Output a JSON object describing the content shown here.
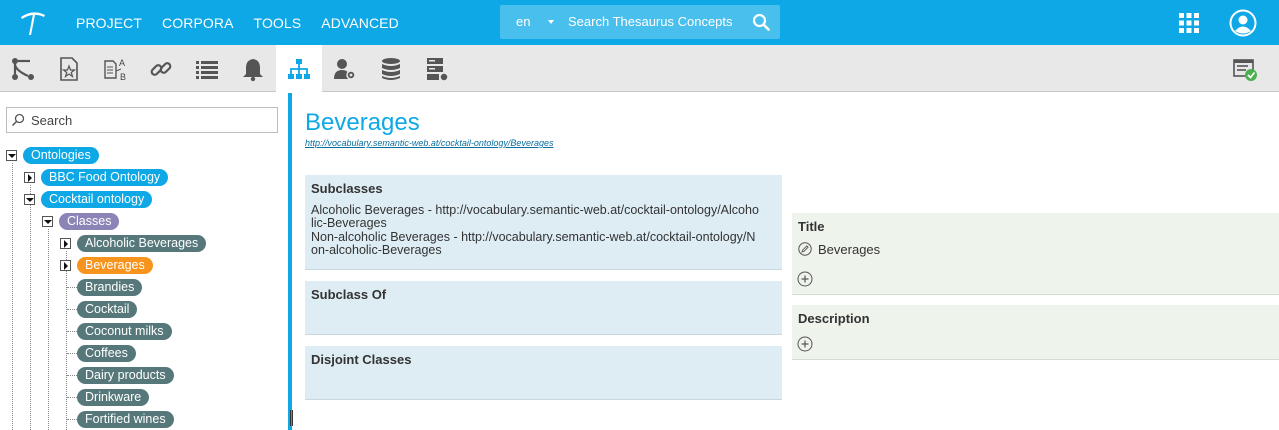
{
  "topbar": {
    "nav": [
      "PROJECT",
      "CORPORA",
      "TOOLS",
      "ADVANCED"
    ],
    "search": {
      "lang": "en",
      "placeholder": "Search Thesaurus Concepts"
    },
    "icons": [
      "logo-icon",
      "search-icon",
      "apps-grid-icon",
      "user-icon"
    ]
  },
  "toolbar": {
    "tools": [
      "hierarchy-branch-icon",
      "document-star-icon",
      "translate-ab-icon",
      "link-icon",
      "list-icon",
      "bell-icon",
      "sitemap-icon",
      "user-settings-icon",
      "database-icon",
      "server-icon"
    ],
    "active": "sitemap-icon",
    "right_icon": "status-check-icon"
  },
  "tree": {
    "search_placeholder": "Search",
    "root": "Ontologies",
    "ontologies": [
      "BBC Food Ontology",
      "Cocktail ontology"
    ],
    "classes_label": "Classes",
    "classes": [
      "Alcoholic Beverages",
      "Beverages",
      "Brandies",
      "Cocktail",
      "Coconut milks",
      "Coffees",
      "Dairy products",
      "Drinkware",
      "Fortified wines"
    ],
    "selected": "Beverages"
  },
  "detail": {
    "title": "Beverages",
    "uri": "http://vocabulary.semantic-web.at/cocktail-ontology/Beverages",
    "subclasses": {
      "label": "Subclasses",
      "lines": [
        "Alcoholic Beverages - http://vocabulary.semantic-web.at/cocktail-ontology/Alcoho",
        "lic-Beverages",
        "Non-alcoholic Beverages - http://vocabulary.semantic-web.at/cocktail-ontology/N",
        "on-alcoholic-Beverages"
      ]
    },
    "subclass_of": {
      "label": "Subclass Of"
    },
    "disjoint": {
      "label": "Disjoint Classes"
    },
    "title_field": {
      "label": "Title",
      "value": "Beverages"
    },
    "description_field": {
      "label": "Description"
    }
  },
  "colors": {
    "brand": "#0ea8e6",
    "selected": "#f7941d",
    "class_pill": "#57787a",
    "classes_pill": "#8b84b6"
  }
}
